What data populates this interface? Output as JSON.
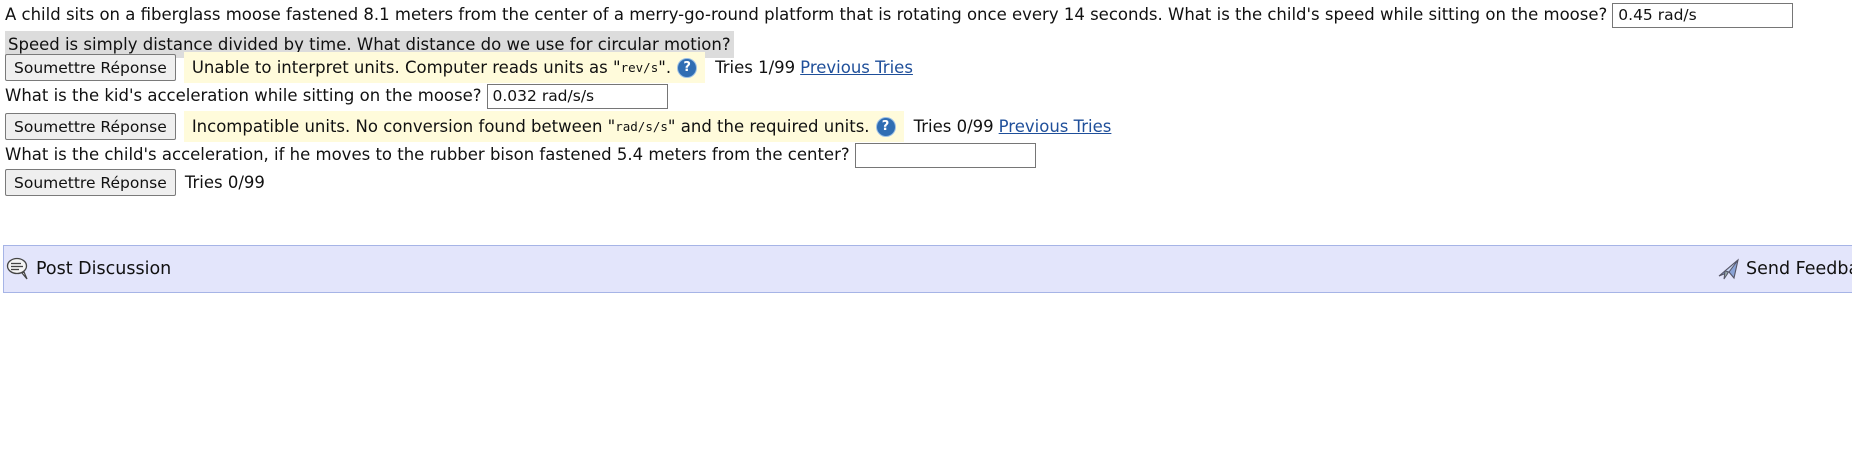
{
  "q1": {
    "question": "A child sits on a fiberglass moose fastened 8.1 meters from the center of a merry-go-round platform that is rotating once every 14 seconds. What is the child's speed while sitting on the moose?",
    "answer_value": "0.45 rad/s",
    "hint": "Speed is simply distance divided by time. What distance do we use for circular motion?",
    "submit_label": "Soumettre Réponse",
    "feedback_before": "Unable to interpret units. Computer reads units as \"",
    "feedback_units": "rev/s",
    "feedback_after": "\".",
    "tries": "Tries 1/99",
    "previous_tries": "Previous Tries"
  },
  "q2": {
    "question": "What is the kid's acceleration while sitting on the moose?",
    "answer_value": "0.032 rad/s/s",
    "submit_label": "Soumettre Réponse",
    "feedback_before": "Incompatible units. No conversion found between \"",
    "feedback_units": "rad/s/s",
    "feedback_after": "\" and the required units.",
    "tries": "Tries 0/99",
    "previous_tries": "Previous Tries"
  },
  "q3": {
    "question": "What is the child's acceleration, if he moves to the rubber bison fastened 5.4 meters from the center?",
    "answer_value": "",
    "submit_label": "Soumettre Réponse",
    "tries": "Tries 0/99"
  },
  "discussion_bar": {
    "post_label": "Post Discussion",
    "feedback_label": "Send Feedback"
  },
  "icons": {
    "help": "help-question-icon",
    "discussion": "discussion-bubble-icon",
    "feedback": "send-feedback-icon"
  },
  "colors": {
    "feedback_bg": "#fffbdb",
    "hint_bg": "#dcdcdc",
    "bar_bg": "#e3e5fb",
    "help_icon": "#2f6db3",
    "link": "#1f4f9a"
  }
}
